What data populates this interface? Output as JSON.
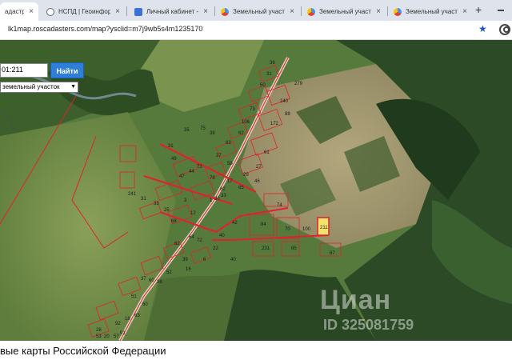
{
  "browser": {
    "tabs": [
      {
        "title": "адастра",
        "icon": "globe-icon",
        "active": true
      },
      {
        "title": "НСПД | Геоинформа",
        "icon": "globe-icon",
        "active": false
      },
      {
        "title": "Личный кабинет - И",
        "icon": "document-icon",
        "active": false
      },
      {
        "title": "Земельный участок",
        "icon": "chrome-icon",
        "active": false
      },
      {
        "title": "Земельный участок",
        "icon": "chrome-icon",
        "active": false
      },
      {
        "title": "Земельный участок",
        "icon": "chrome-icon",
        "active": false
      }
    ],
    "close_glyph": "×",
    "new_tab_glyph": "+",
    "url": "lk1map.roscadasters.com/map?ysclid=m7j9wb5s4m1235170"
  },
  "map_controls": {
    "search_value": "01:211",
    "find_label": "Найти",
    "object_type": "земельный участок"
  },
  "parcels": [
    "36",
    "31",
    "50",
    "279",
    "240",
    "88",
    "172",
    "73",
    "106",
    "62",
    "63",
    "37",
    "58",
    "61",
    "27",
    "29",
    "65",
    "82",
    "90",
    "241",
    "31",
    "33",
    "25",
    "47",
    "44",
    "38",
    "35",
    "75",
    "31",
    "49",
    "73",
    "78",
    "46",
    "17",
    "33",
    "1",
    "3",
    "74",
    "12",
    "68",
    "84",
    "42",
    "70",
    "40",
    "22",
    "6",
    "40",
    "16",
    "52",
    "60",
    "64",
    "72",
    "100",
    "211",
    "231",
    "65",
    "67",
    "62",
    "39",
    "36",
    "51",
    "60",
    "63",
    "18",
    "92",
    "91",
    "57",
    "28",
    "20",
    "53",
    "37"
  ],
  "highlighted_parcel": "211",
  "watermark": {
    "brand": "Циан",
    "id": "ID 325081759"
  },
  "footer_text": "вые карты Российской Федерации",
  "colors": {
    "parcel_border": "#e0222c",
    "highlight_fill": "#f3e36a",
    "find_button": "#2f7ed8"
  }
}
